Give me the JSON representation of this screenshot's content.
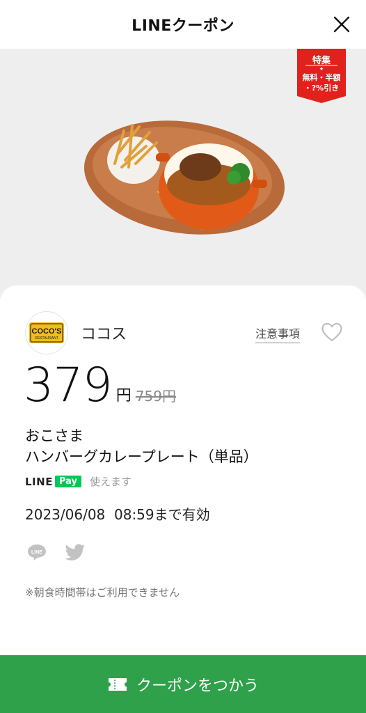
{
  "header": {
    "title": "LINEクーポン"
  },
  "hero": {
    "badge": {
      "line1": "特集",
      "line2": "無料・半額",
      "line3": "・?%引き"
    }
  },
  "coupon": {
    "logo_text": {
      "top": "COCO'S",
      "bottom": "RESTAURANT"
    },
    "brand": "ココス",
    "notes_link": "注意事項",
    "price": "379",
    "price_unit": "円",
    "original_price": "759円",
    "title_line1": "おこさま",
    "title_line2": "ハンバーグカレープレート（単品）",
    "pay": {
      "line": "LINE",
      "pay": "Pay",
      "usable": "使えます"
    },
    "expiry": "2023/06/08  08:59まで有効",
    "share_line_label": "LINE",
    "note": "※朝食時間帯はご利用できません"
  },
  "cta": {
    "label": "クーポンをつかう"
  },
  "colors": {
    "accent": "#2fa14a",
    "line_green": "#06c755",
    "badge_red": "#e0211c"
  }
}
